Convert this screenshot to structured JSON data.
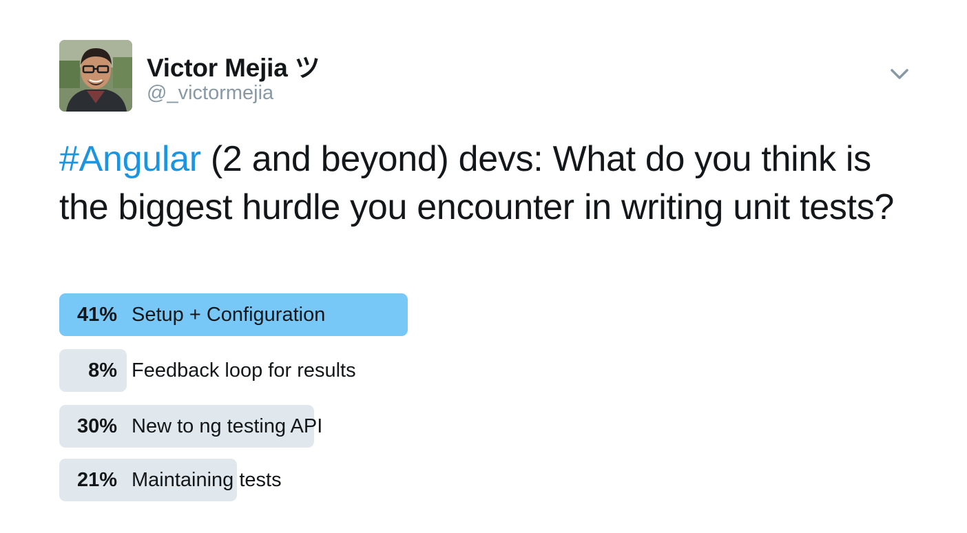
{
  "author": {
    "display_name": "Victor Mejia ツ",
    "screen_name": "@_victormejia",
    "avatar_icon": "user-avatar"
  },
  "menu": {
    "icon": "chevron-down-icon"
  },
  "tweet": {
    "hashtag": "#Angular",
    "text_rest": " (2 and beyond) devs: What do you think is the biggest hurdle you encounter in writing unit tests?"
  },
  "poll": {
    "options": [
      {
        "percent_label": "41%",
        "percent": 41,
        "label": "Setup + Configuration",
        "winner": true
      },
      {
        "percent_label": "8%",
        "percent": 8,
        "label": "Feedback loop for results",
        "winner": false
      },
      {
        "percent_label": "30%",
        "percent": 30,
        "label": "New to ng testing API",
        "winner": false
      },
      {
        "percent_label": "21%",
        "percent": 21,
        "label": "Maintaining tests",
        "winner": false
      }
    ]
  },
  "colors": {
    "text": "#14171a",
    "secondary": "#8899a6",
    "hashtag": "#1b95e0",
    "poll_winner": "#77c7f7",
    "poll_other": "#e1e8ed"
  }
}
